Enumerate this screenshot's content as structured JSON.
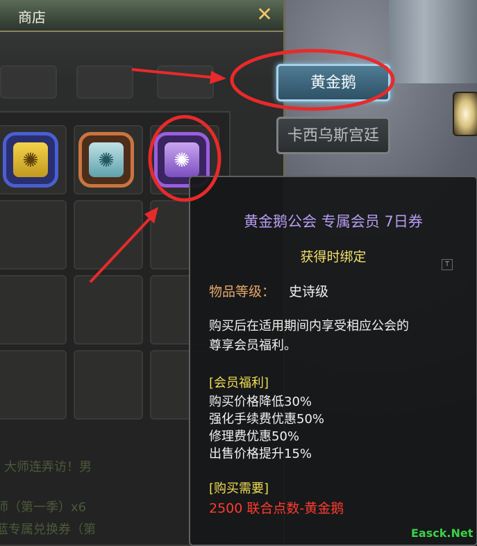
{
  "shop": {
    "title": "商店",
    "close_glyph": "✕"
  },
  "tabs": [
    {
      "label": "黄金鹅",
      "active": true
    },
    {
      "label": "卡西乌斯宫廷",
      "active": false
    }
  ],
  "items": [
    {
      "icon": "gold-emblem-icon",
      "glyph": "✺"
    },
    {
      "icon": "teal-emblem-icon",
      "glyph": "✺"
    },
    {
      "icon": "purple-emblem-icon",
      "glyph": "✺"
    }
  ],
  "tooltip": {
    "title": "黄金鹅公会 专属会员 7日券",
    "bind": "获得时绑定",
    "grade_label": "物品等级：",
    "grade_value": "史诗级",
    "desc_line1": "购买后在适用期间内享受相应公会的",
    "desc_line2": "尊享会员福利。",
    "benefits_header": "[会员福利]",
    "benefits": [
      "购买价格降低30%",
      "强化手续费优惠50%",
      "修理费优惠50%",
      "出售价格提升15%"
    ],
    "requirement_header": "[购买需要]",
    "price": "2500 联合点数-黄金鹅",
    "corner_mark": "T"
  },
  "background_text": {
    "line1": "大师连弄访！男",
    "line2": "师（第一季）x6",
    "line3": "蓝专属兑换券（第"
  },
  "watermark": "Easck.Net",
  "colors": {
    "annotation_red": "#e82a2a",
    "tab_active": "#4f7c95",
    "item_name": "#b89cf2",
    "price": "#ff3b30"
  }
}
